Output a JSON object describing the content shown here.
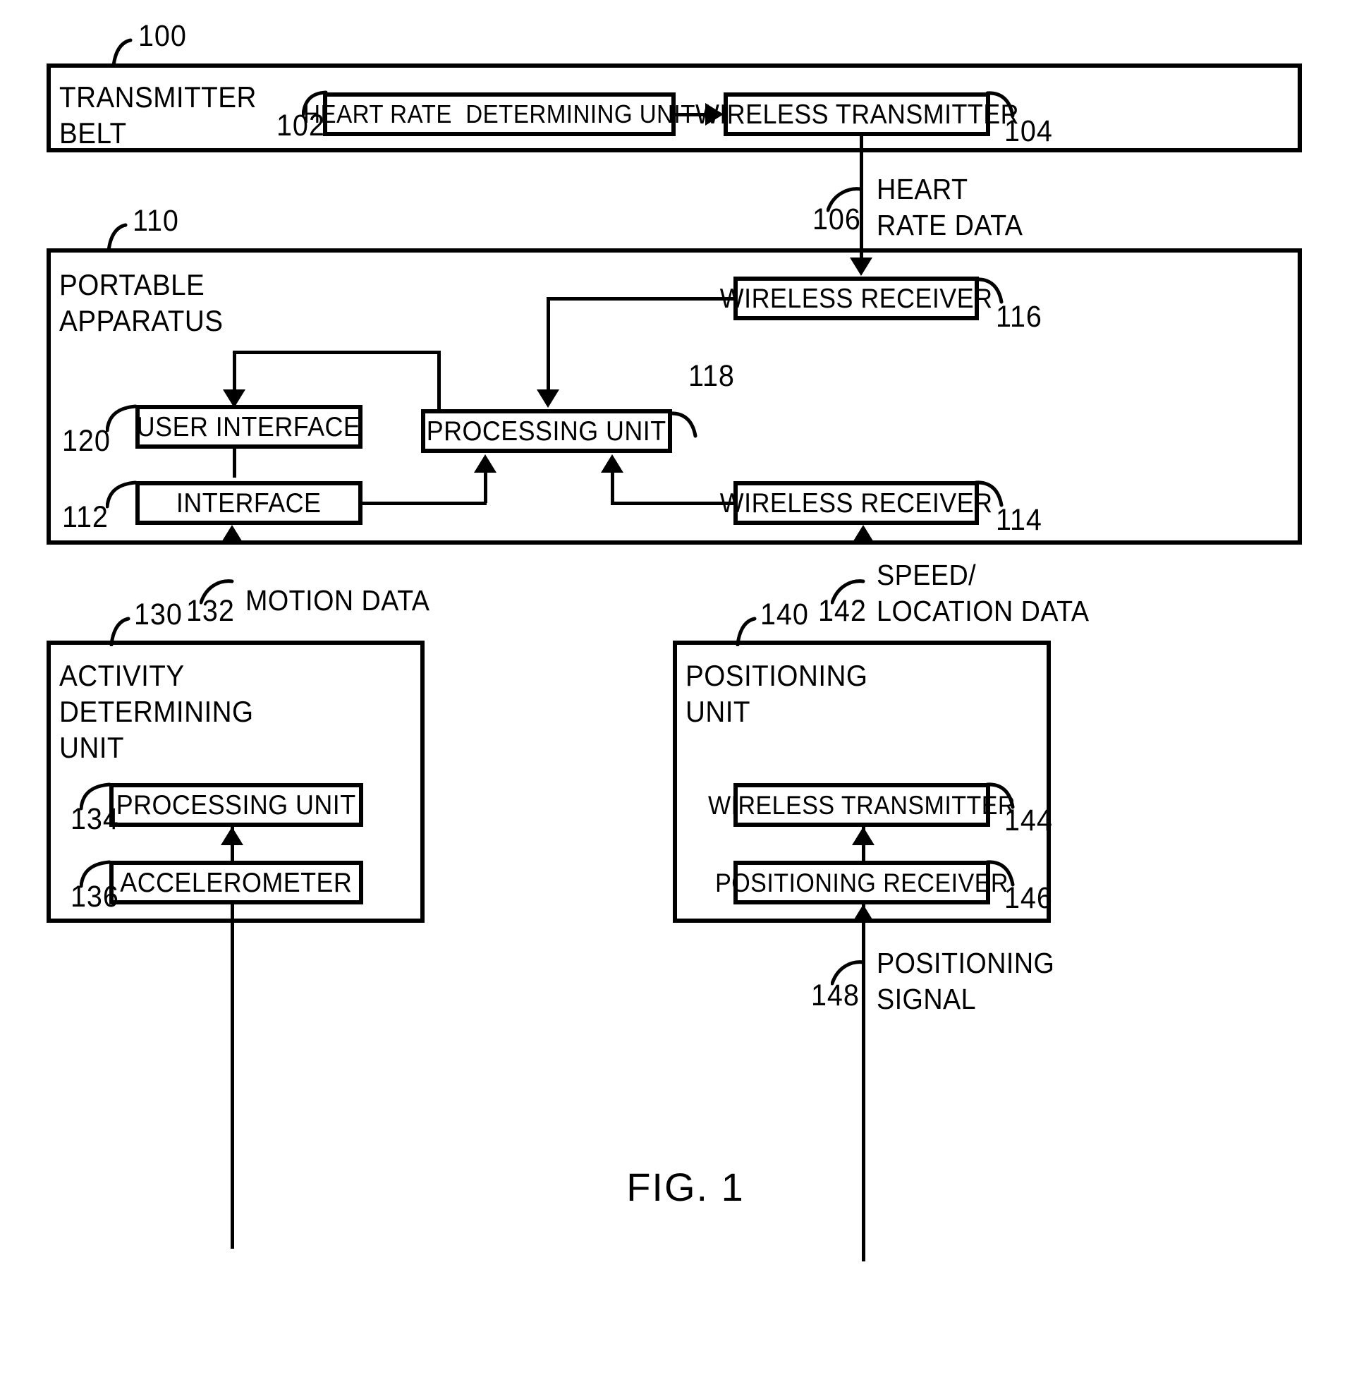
{
  "figure": {
    "caption": "FIG. 1"
  },
  "blocks": {
    "transmitter_belt": {
      "title": "TRANSMITTER\nBELT",
      "ref": "100"
    },
    "heart_rate_determining_unit": {
      "label": "HEART RATE  DETERMINING UNIT",
      "ref": "102"
    },
    "wireless_transmitter_belt": {
      "label": "WIRELESS TRANSMITTER",
      "ref": "104"
    },
    "portable_apparatus": {
      "title": "PORTABLE\nAPPARATUS",
      "ref": "110"
    },
    "wireless_receiver_116": {
      "label": "WIRELESS RECEIVER",
      "ref": "116"
    },
    "processing_unit_118": {
      "label": "PROCESSING UNIT",
      "ref": "118"
    },
    "user_interface_120": {
      "label": "USER INTERFACE",
      "ref": "120"
    },
    "interface_112": {
      "label": "INTERFACE",
      "ref": "112"
    },
    "wireless_receiver_114": {
      "label": "WIRELESS RECEIVER",
      "ref": "114"
    },
    "activity_determining_unit": {
      "title": "ACTIVITY\nDETERMINING\nUNIT",
      "ref": "130"
    },
    "processing_unit_134": {
      "label": "PROCESSING UNIT",
      "ref": "134"
    },
    "accelerometer_136": {
      "label": "ACCELEROMETER",
      "ref": "136"
    },
    "positioning_unit": {
      "title": "POSITIONING\nUNIT",
      "ref": "140"
    },
    "wireless_transmitter_144": {
      "label": "WIRELESS TRANSMITTER",
      "ref": "144"
    },
    "positioning_receiver_146": {
      "label": "POSITIONING RECEIVER",
      "ref": "146"
    }
  },
  "signals": {
    "heart_rate_data": {
      "label": "HEART\nRATE DATA",
      "ref": "106"
    },
    "motion_data": {
      "label": "MOTION DATA",
      "ref": "132"
    },
    "speed_location_data": {
      "label": "SPEED/\nLOCATION DATA",
      "ref": "142"
    },
    "positioning_signal": {
      "label": "POSITIONING\nSIGNAL",
      "ref": "148"
    }
  },
  "colors": {
    "ink": "#000000",
    "paper": "#ffffff"
  }
}
